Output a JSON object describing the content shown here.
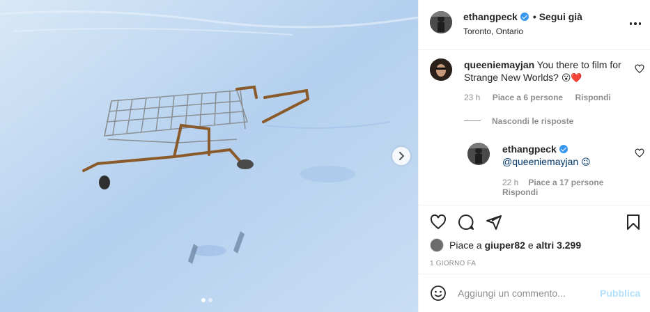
{
  "header": {
    "username": "ethangpeck",
    "bullet": "•",
    "follow_label": "Segui già",
    "location": "Toronto, Ontario"
  },
  "comment1": {
    "username": "queeniemayjan",
    "text": "You there to film for Strange New Worlds?",
    "emoji": "😮❤️",
    "time": "23 h",
    "likes": "Piace a 6 persone",
    "reply": "Rispondi"
  },
  "hide_replies": "Nascondi le risposte",
  "reply1": {
    "username": "ethangpeck",
    "mention": "@queeniemayjan",
    "emoji": "😉",
    "time": "22 h",
    "likes": "Piace a 17 persone",
    "reply": "Rispondi"
  },
  "likes": {
    "prefix": "Piace a",
    "user": "giuper82",
    "and": "e",
    "others": "altri 3.299"
  },
  "date": "1 GIORNO FA",
  "add_comment": {
    "placeholder": "Aggiungi un commento...",
    "publish": "Pubblica"
  },
  "carousel": {
    "count": 2,
    "active": 0
  },
  "colors": {
    "verified": "#3897f0",
    "publish_disabled": "#b2dffc",
    "mention": "#00376b",
    "muted": "#8e8e8e"
  },
  "icons": [
    "verified-badge-icon",
    "more-options-icon",
    "heart-icon",
    "comment-icon",
    "share-icon",
    "bookmark-icon",
    "emoji-icon",
    "next-arrow-icon"
  ]
}
